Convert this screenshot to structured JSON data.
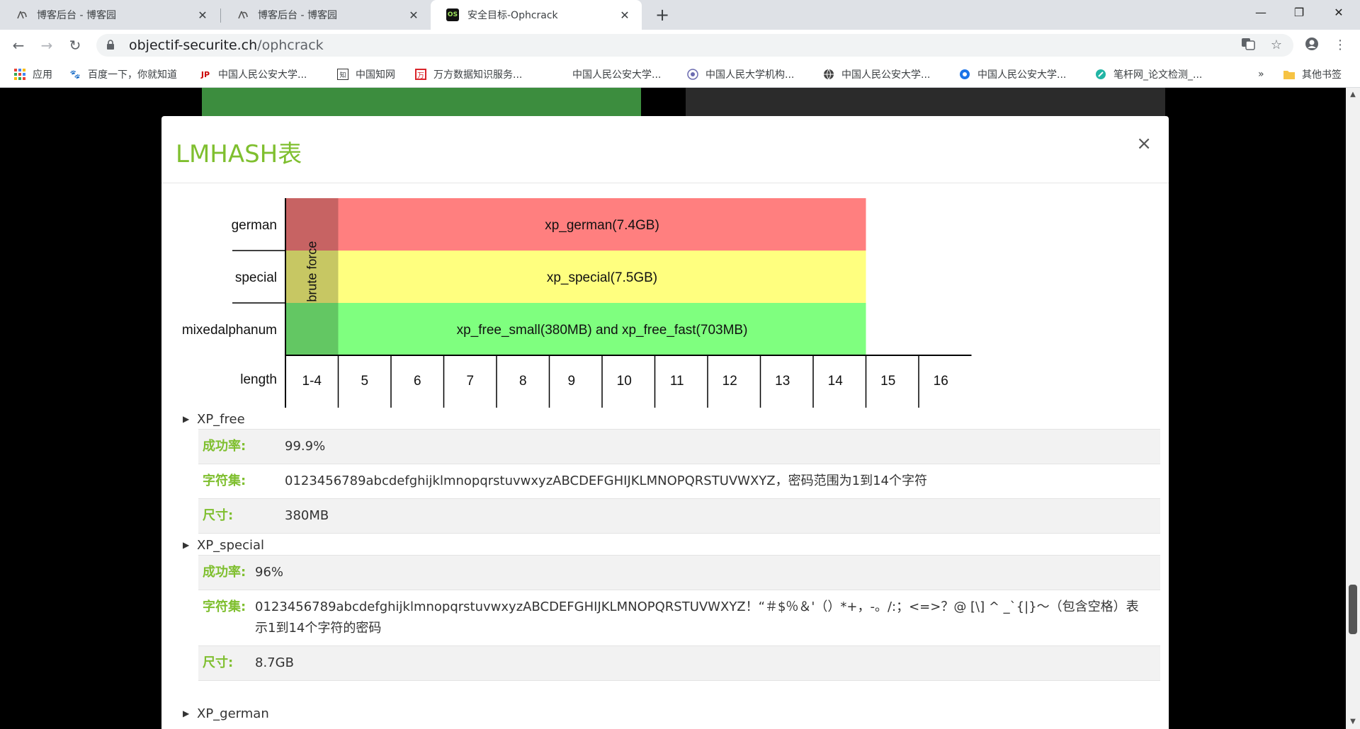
{
  "browser": {
    "tabs": [
      {
        "label": "博客后台 - 博客园",
        "icon": "cnblogs-icon"
      },
      {
        "label": "博客后台 - 博客园",
        "icon": "cnblogs-icon"
      },
      {
        "label": "安全目标-Ophcrack",
        "icon": "os-icon",
        "icon_text": "OS"
      }
    ],
    "url_host": "objectif-securite.ch",
    "url_path": "/ophcrack",
    "bookmarks": [
      "应用",
      "百度一下，你就知道",
      "中国人民公安大学...",
      "中国知网",
      "万方数据知识服务...",
      "中国人民公安大学...",
      "中国人民大学机构...",
      "中国人民公安大学...",
      "中国人民公安大学...",
      "笔杆网_论文检测_..."
    ],
    "bookmarks_overflow": "»",
    "other_bookmarks": "其他书签"
  },
  "modal": {
    "title": "LMHASH表",
    "close": "×"
  },
  "chart_data": {
    "type": "table",
    "rows": [
      {
        "label": "german",
        "table": "xp_german(7.4GB)",
        "color": "#ff7f7f"
      },
      {
        "label": "special",
        "table": "xp_special(7.5GB)",
        "color": "#ffff7f"
      },
      {
        "label": "mixedalphanum",
        "table": "xp_free_small(380MB) and xp_free_fast(703MB)",
        "color": "#7fff7f"
      }
    ],
    "brute_force_label": "brute force",
    "length_label": "length",
    "lengths": [
      "1-4",
      "5",
      "6",
      "7",
      "8",
      "9",
      "10",
      "11",
      "12",
      "13",
      "14",
      "15",
      "16"
    ],
    "covered_up_to": "14"
  },
  "sections": [
    {
      "name": "XP_free",
      "rows": [
        {
          "key": "成功率:",
          "value": "99.9%"
        },
        {
          "key": "字符集:",
          "value": "0123456789abcdefghijklmnopqrstuvwxyzABCDEFGHIJKLMNOPQRSTUVWXYZ，密码范围为1到14个字符"
        },
        {
          "key": "尺寸:",
          "value": "380MB"
        }
      ]
    },
    {
      "name": "XP_special",
      "rows": [
        {
          "key": "成功率:",
          "value": "96%"
        },
        {
          "key": "字符集:",
          "value": "0123456789abcdefghijklmnopqrstuvwxyzABCDEFGHIJKLMNOPQRSTUVWXYZ！“＃$％＆'（）*+，-。/:；<=>？@ [\\] ^ _`{|}〜（包含空格）表示1到14个字符的密码"
        },
        {
          "key": "尺寸:",
          "value": "8.7GB"
        }
      ]
    },
    {
      "name": "XP_german",
      "rows": []
    }
  ]
}
